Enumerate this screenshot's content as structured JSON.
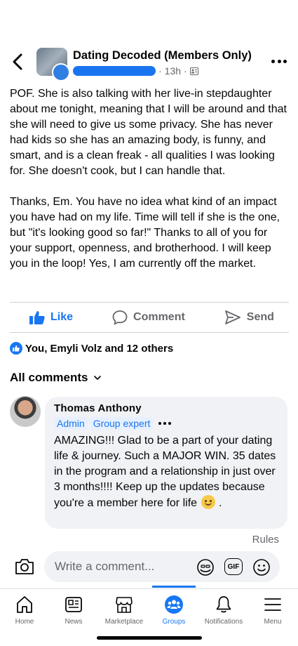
{
  "header": {
    "group_name": "Dating Decoded (Members Only)",
    "time": "13h",
    "separator": "·"
  },
  "post": {
    "paragraphs": [
      "POF.  She is also talking with her live-in stepdaughter about me tonight, meaning that I will be around and that she will need to give us some privacy.  She has never had kids so she has an amazing body, is funny, and smart, and is a clean freak - all qualities I was looking for.  She doesn't cook, but I can handle that.",
      "Thanks, Em.  You have no idea what kind of an impact you have had on my life.  Time will tell if she is the one, but \"it's looking good so far!\"  Thanks to all of you for your support, openness, and brotherhood.  I will keep you in the loop!  Yes, I am currently off the market."
    ]
  },
  "actions": {
    "like": "Like",
    "comment": "Comment",
    "send": "Send"
  },
  "reactions": {
    "summary": "You, Emyli Volz and 12 others"
  },
  "comments_header": "All comments",
  "comment": {
    "author": "Thomas Anthony",
    "badges": [
      "Admin",
      "Group expert"
    ],
    "text": "AMAZING!!! Glad to be a part of your dating life & journey. Such a MAJOR WIN. 35 dates in the program and a relationship in just over 3 months!!!! Keep up the updates because you're a member here for life",
    "text_end": " ."
  },
  "rules_label": "Rules",
  "composer": {
    "placeholder": "Write a comment...",
    "gif_label": "GIF"
  },
  "tabs": [
    {
      "label": "Home",
      "icon": "home-icon"
    },
    {
      "label": "News",
      "icon": "news-icon"
    },
    {
      "label": "Marketplace",
      "icon": "marketplace-icon"
    },
    {
      "label": "Groups",
      "icon": "groups-icon",
      "active": true
    },
    {
      "label": "Notifications",
      "icon": "bell-icon"
    },
    {
      "label": "Menu",
      "icon": "menu-icon"
    }
  ],
  "colors": {
    "accent": "#1877f2",
    "secondary_text": "#65676b",
    "bubble": "#f0f2f5"
  }
}
